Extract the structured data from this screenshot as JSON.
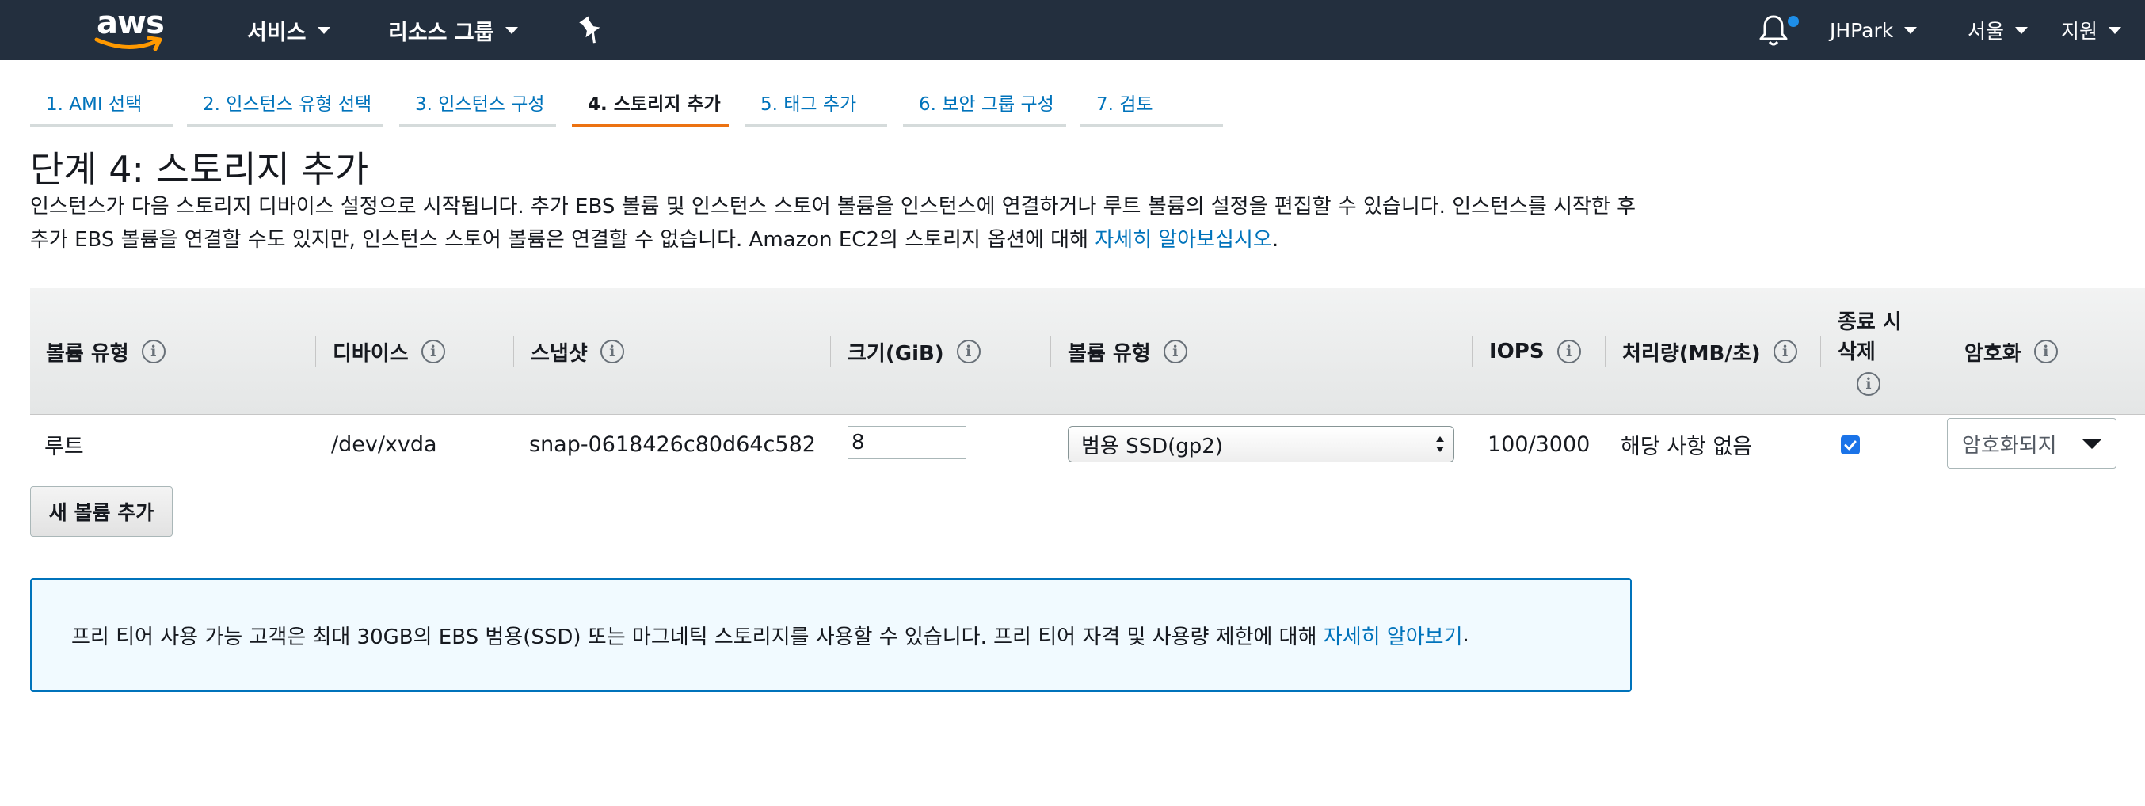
{
  "header": {
    "logo_text": "aws",
    "services_label": "서비스",
    "resource_groups_label": "리소스 그룹",
    "user_label": "JHPark",
    "region_label": "서울",
    "support_label": "지원",
    "notification_dot_color": "#1e8ee8"
  },
  "wizard": {
    "tabs": [
      {
        "label": "1. AMI 선택",
        "active": false
      },
      {
        "label": "2. 인스턴스 유형 선택",
        "active": false
      },
      {
        "label": "3. 인스턴스 구성",
        "active": false
      },
      {
        "label": "4. 스토리지 추가",
        "active": true
      },
      {
        "label": "5. 태그 추가",
        "active": false
      },
      {
        "label": "6. 보안 그룹 구성",
        "active": false
      },
      {
        "label": "7. 검토",
        "active": false
      }
    ],
    "active_color": "#ec7211"
  },
  "page": {
    "title": "단계 4: 스토리지 추가",
    "description": "인스턴스가 다음 스토리지 디바이스 설정으로 시작됩니다. 추가 EBS 볼륨 및 인스턴스 스토어 볼륨을 인스턴스에 연결하거나 루트 볼륨의 설정을 편집할 수 있습니다. 인스턴스를 시작한 후 추가 EBS 볼륨을 연결할 수도 있지만, 인스턴스 스토어 볼륨은 연결할 수 없습니다. Amazon EC2의 스토리지 옵션에 대해",
    "description_link": "자세히 알아보십시오",
    "description_end": "."
  },
  "table": {
    "headers": {
      "volume_type": "볼륨 유형",
      "device": "디바이스",
      "snapshot": "스냅샷",
      "size": "크기(GiB)",
      "ebs_volume_type": "볼륨 유형",
      "iops": "IOPS",
      "throughput": "처리량(MB/초)",
      "delete_on_termination_line1": "종료 시",
      "delete_on_termination_line2": "삭제",
      "encryption": "암호화"
    },
    "info_glyph": "i",
    "rows": [
      {
        "volume_type": "루트",
        "device": "/dev/xvda",
        "snapshot": "snap-0618426c80d64c582",
        "size": "8",
        "ebs_volume_type": "범용 SSD(gp2)",
        "iops": "100/3000",
        "throughput": "해당 사항 없음",
        "delete_on_termination": true,
        "encryption": "암호화되지"
      }
    ]
  },
  "add_volume_label": "새 볼륨 추가",
  "info_box": {
    "text": "프리 티어 사용 가능 고객은 최대 30GB의 EBS 범용(SSD) 또는 마그네틱 스토리지를 사용할 수 있습니다. 프리 티어 자격 및 사용량 제한에 대해",
    "link": "자세히 알아보기",
    "end": "."
  },
  "colors": {
    "nav_bg": "#232f3e",
    "link": "#0073bb",
    "info_border": "#0073bb",
    "info_bg": "#f1faff",
    "checkbox": "#1a73e8"
  }
}
